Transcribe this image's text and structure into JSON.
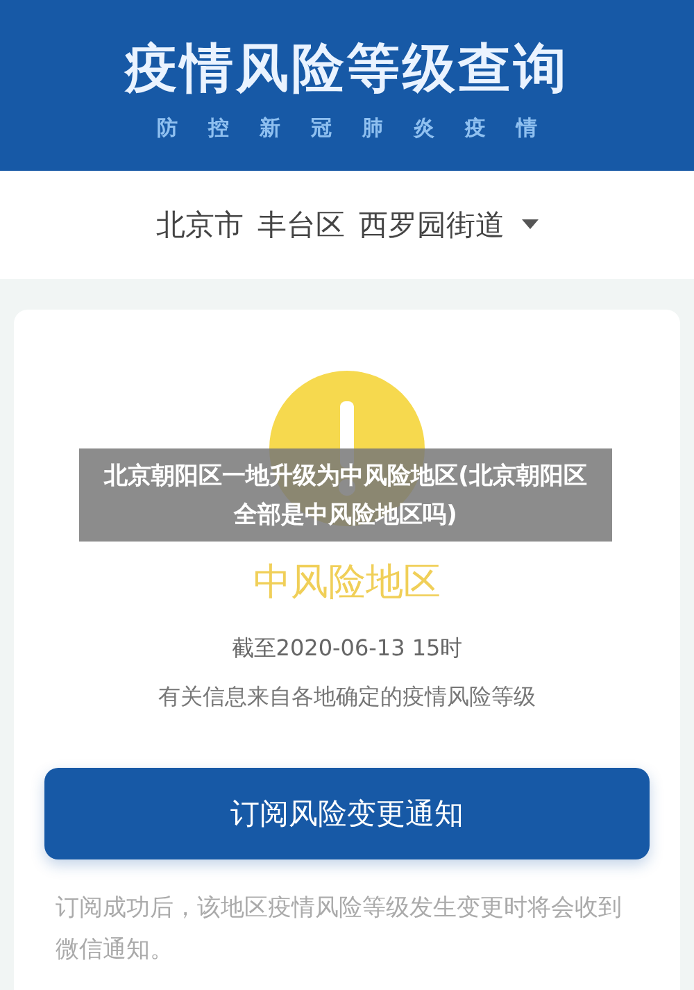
{
  "header": {
    "title": "疫情风险等级查询",
    "subtitle": "防控新冠肺炎疫情"
  },
  "location": {
    "parts": [
      "北京市",
      "丰台区",
      "西罗园街道"
    ]
  },
  "result": {
    "risk_level": "中风险地区",
    "as_of": "截至2020-06-13 15时",
    "source_note": "有关信息来自各地确定的疫情风险等级"
  },
  "subscribe_button": "订阅风险变更通知",
  "subscribe_note": "订阅成功后，该地区疫情风险等级发生变更时将会收到微信通知。",
  "overlay_caption": "北京朝阳区一地升级为中风险地区(北京朝阳区全部是中风险地区吗)"
}
